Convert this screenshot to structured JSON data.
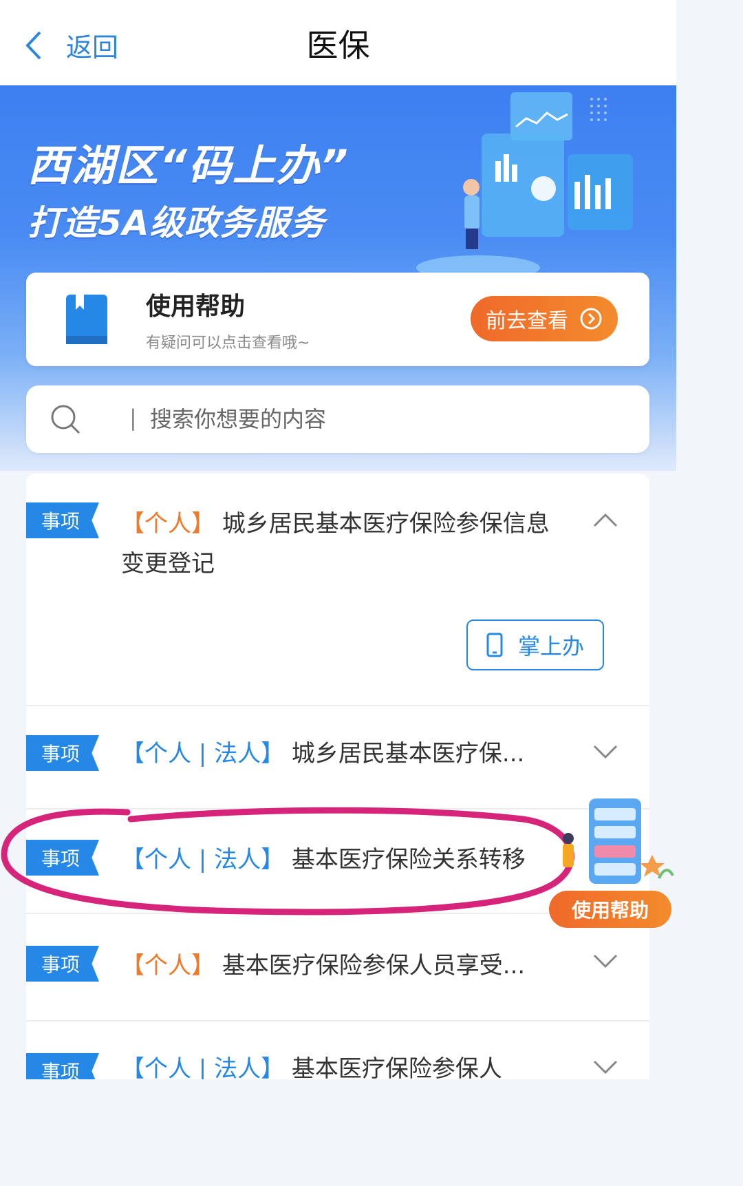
{
  "nav": {
    "back_label": "返回",
    "title": "医保"
  },
  "banner": {
    "title": "西湖区“码上办”",
    "subtitle": "打造5A级政务服务"
  },
  "help": {
    "title": "使用帮助",
    "desc": "有疑问可以点击查看哦~",
    "button": "前去查看"
  },
  "search": {
    "placeholder": "搜索你想要的内容"
  },
  "items": [
    {
      "tag": "事项",
      "scope": "【个人】",
      "text": "城乡居民基本医疗保险参保信息变更登记",
      "expanded": true,
      "action": "掌上办"
    },
    {
      "tag": "事项",
      "scope": "【个人 | 法人】",
      "text": "城乡居民基本医疗保..."
    },
    {
      "tag": "事项",
      "scope": "【个人 | 法人】",
      "text": "基本医疗保险关系转移"
    },
    {
      "tag": "事项",
      "scope": "【个人】",
      "text": "基本医疗保险参保人员享受..."
    },
    {
      "tag": "事项",
      "scope": "【个人 | 法人】",
      "text": "基本医疗保险参保人"
    }
  ],
  "float_help": {
    "label": "使用帮助"
  },
  "colors": {
    "primary": "#2688e6",
    "accent": "#f0692a",
    "annotation": "#d6247a"
  },
  "icons": [
    "back-chevron-icon",
    "book-icon",
    "arrow-right-circle-icon",
    "search-icon",
    "chevron-up-icon",
    "chevron-down-icon",
    "phone-icon"
  ]
}
